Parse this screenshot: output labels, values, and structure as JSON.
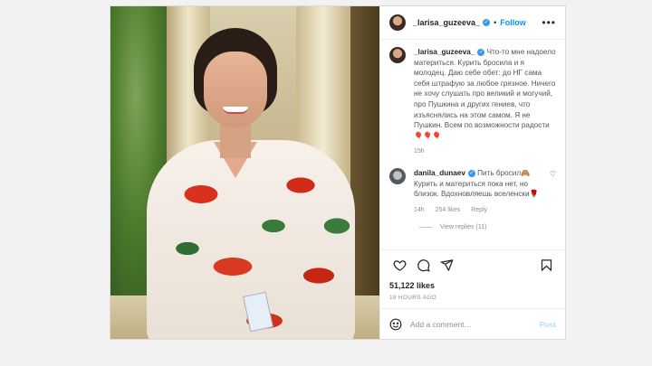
{
  "header": {
    "username": "_larisa_guzeeva_",
    "separator": "•",
    "follow_label": "Follow",
    "more_label": "•••"
  },
  "caption": {
    "username": "_larisa_guzeeva_",
    "text": "Что-то мне надоело материться. Курить бросила и я молодец. Даю себе обет: до НГ сама себя штрафую за любое грязное. Ничего не хочу слушать про великий и могучий, про Пушкина и других гениев, что изъяснялись на этом самом. Я не Пушкин. Всем по возможности радости🎈🎈🎈",
    "time": "15h"
  },
  "comment": {
    "username": "danila_dunaev",
    "text": "Пить бросил🙈 Курить и материться пока нет, но близок. Вдохновляешь вселенски🌹",
    "time": "14h",
    "likes": "254 likes",
    "reply_label": "Reply",
    "view_replies": "View replies (11)"
  },
  "post": {
    "likes": "51,122 likes",
    "time_ago": "19 HOURS AGO"
  },
  "add_comment": {
    "placeholder": "Add a comment…",
    "post_label": "Post"
  },
  "icons": {
    "like": "heart-icon",
    "comment": "comment-icon",
    "share": "send-icon",
    "save": "bookmark-icon",
    "emoji": "smiley-icon"
  },
  "colors": {
    "accent": "#0095f6",
    "verified": "#3897f0",
    "muted": "#8e8e8e",
    "post_disabled": "#b2dffc"
  }
}
